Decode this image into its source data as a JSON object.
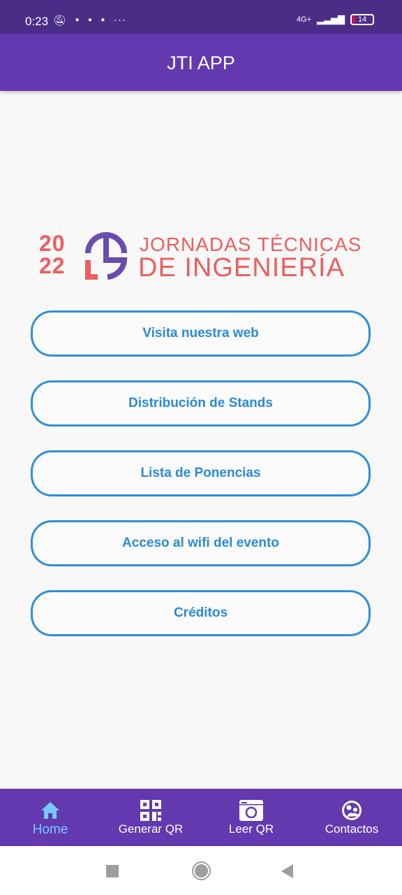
{
  "status_bar": {
    "time": "0:23",
    "network": "4G+",
    "battery": "14"
  },
  "app_bar": {
    "title": "JTI APP"
  },
  "logo": {
    "year_top": "20",
    "year_bottom": "22",
    "line1": "JORNADAS TÉCNICAS",
    "line2": "DE INGENIERÍA"
  },
  "buttons": [
    {
      "label": "Visita nuestra web"
    },
    {
      "label": "Distribución de Stands"
    },
    {
      "label": "Lista de Ponencias"
    },
    {
      "label": "Acceso al wifi del evento"
    },
    {
      "label": "Créditos"
    }
  ],
  "bottom_nav": [
    {
      "label": "Home",
      "icon": "home-icon",
      "active": true
    },
    {
      "label": "Generar QR",
      "icon": "qr-code-icon"
    },
    {
      "label": "Leer QR",
      "icon": "camera-icon"
    },
    {
      "label": "Contactos",
      "icon": "contacts-icon"
    }
  ],
  "colors": {
    "primary": "#6239ae",
    "status": "#4a2d87",
    "button": "#2f8fdc",
    "logo_red": "#ec5f5f",
    "logo_purple": "#6a4bb0",
    "active": "#78c9ff"
  }
}
